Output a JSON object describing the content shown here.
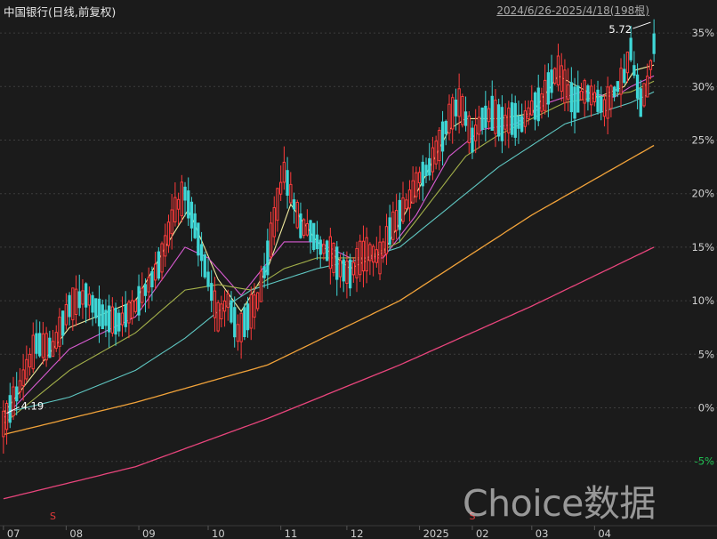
{
  "header": {
    "title": "中国银行(日线,前复权)",
    "range": "2024/6/26-2025/4/18(198根)"
  },
  "watermark": "Choice数据",
  "chart_data": {
    "type": "candlestick",
    "title": "中国银行(日线,前复权)",
    "date_range": "2024/6/26-2025/4/18",
    "bar_count": 198,
    "y_unit": "% change",
    "y_ticks": [
      "35%",
      "30%",
      "25%",
      "20%",
      "15%",
      "10%",
      "5%",
      "0%",
      "-5%"
    ],
    "ylim": [
      -8,
      37
    ],
    "x_ticks": [
      "07",
      "08",
      "09",
      "10",
      "11",
      "12",
      "2025",
      "02",
      "03",
      "04"
    ],
    "annotations": {
      "low_price": "4.19",
      "high_price": "5.72"
    },
    "price_path": [
      [
        0,
        -1.5
      ],
      [
        5,
        2
      ],
      [
        10,
        6
      ],
      [
        15,
        5.5
      ],
      [
        20,
        9.5
      ],
      [
        25,
        10.5
      ],
      [
        30,
        8.5
      ],
      [
        35,
        8
      ],
      [
        40,
        9.5
      ],
      [
        45,
        12
      ],
      [
        48,
        14
      ],
      [
        52,
        18.5
      ],
      [
        55,
        20
      ],
      [
        58,
        17
      ],
      [
        62,
        12
      ],
      [
        65,
        8.5
      ],
      [
        68,
        10
      ],
      [
        71,
        7
      ],
      [
        74,
        8.5
      ],
      [
        77,
        10
      ],
      [
        80,
        14
      ],
      [
        83,
        19
      ],
      [
        85,
        22
      ],
      [
        87,
        20
      ],
      [
        90,
        17
      ],
      [
        93,
        16.5
      ],
      [
        96,
        15
      ],
      [
        99,
        14.5
      ],
      [
        102,
        13
      ],
      [
        105,
        12.5
      ],
      [
        108,
        14
      ],
      [
        111,
        14.5
      ],
      [
        114,
        14
      ],
      [
        117,
        16.5
      ],
      [
        120,
        18
      ],
      [
        123,
        19.5
      ],
      [
        126,
        21.5
      ],
      [
        129,
        22.5
      ],
      [
        132,
        24.5
      ],
      [
        135,
        27
      ],
      [
        138,
        28.5
      ],
      [
        140,
        27
      ],
      [
        142,
        25
      ],
      [
        145,
        27
      ],
      [
        148,
        27.5
      ],
      [
        151,
        26.5
      ],
      [
        154,
        27
      ],
      [
        157,
        26.5
      ],
      [
        160,
        28
      ],
      [
        163,
        28.5
      ],
      [
        166,
        30.5
      ],
      [
        168,
        31.5
      ],
      [
        170,
        30
      ],
      [
        173,
        28.5
      ],
      [
        176,
        29.5
      ],
      [
        179,
        29
      ],
      [
        182,
        28
      ],
      [
        184,
        29
      ],
      [
        186,
        30
      ],
      [
        188,
        31
      ],
      [
        190,
        33.5
      ],
      [
        191,
        31.5
      ],
      [
        193,
        28.5
      ],
      [
        195,
        30
      ],
      [
        196,
        32
      ],
      [
        197,
        34
      ]
    ],
    "series": [
      {
        "name": "",
        "color": "#f2ec9f",
        "path": [
          [
            0,
            -0.5
          ],
          [
            20,
            7.5
          ],
          [
            40,
            10
          ],
          [
            50,
            15.5
          ],
          [
            56,
            18.5
          ],
          [
            65,
            12
          ],
          [
            72,
            9
          ],
          [
            80,
            13
          ],
          [
            87,
            19
          ],
          [
            95,
            15.5
          ],
          [
            105,
            13
          ],
          [
            115,
            14.5
          ],
          [
            125,
            20
          ],
          [
            135,
            26
          ],
          [
            140,
            27
          ],
          [
            150,
            27
          ],
          [
            160,
            27.5
          ],
          [
            168,
            31
          ],
          [
            180,
            29
          ],
          [
            188,
            30
          ],
          [
            191,
            31.5
          ],
          [
            197,
            32
          ]
        ]
      },
      {
        "name": "",
        "color": "#d85bd1",
        "path": [
          [
            0,
            -1
          ],
          [
            20,
            5.5
          ],
          [
            40,
            8.5
          ],
          [
            55,
            15
          ],
          [
            62,
            14
          ],
          [
            72,
            10.5
          ],
          [
            85,
            15.5
          ],
          [
            95,
            15.5
          ],
          [
            105,
            14
          ],
          [
            115,
            14
          ],
          [
            125,
            18
          ],
          [
            135,
            23.5
          ],
          [
            145,
            26
          ],
          [
            155,
            26.5
          ],
          [
            165,
            28.5
          ],
          [
            175,
            29.5
          ],
          [
            185,
            29
          ],
          [
            190,
            30
          ],
          [
            197,
            31
          ]
        ]
      },
      {
        "name": "",
        "color": "#a3b04a",
        "path": [
          [
            0,
            -1.5
          ],
          [
            20,
            3.5
          ],
          [
            40,
            7
          ],
          [
            55,
            11
          ],
          [
            65,
            11.5
          ],
          [
            75,
            11
          ],
          [
            85,
            13
          ],
          [
            95,
            14
          ],
          [
            110,
            14
          ],
          [
            120,
            15.5
          ],
          [
            130,
            19.5
          ],
          [
            140,
            23.5
          ],
          [
            150,
            25.5
          ],
          [
            160,
            27
          ],
          [
            170,
            28.5
          ],
          [
            180,
            29
          ],
          [
            190,
            29.5
          ],
          [
            197,
            30.5
          ]
        ]
      },
      {
        "name": "",
        "color": "#5fc7c2",
        "path": [
          [
            0,
            -0.5
          ],
          [
            20,
            1
          ],
          [
            40,
            3.5
          ],
          [
            55,
            6.5
          ],
          [
            65,
            9
          ],
          [
            75,
            11
          ],
          [
            85,
            12
          ],
          [
            95,
            13
          ],
          [
            110,
            14
          ],
          [
            120,
            15
          ],
          [
            130,
            17.5
          ],
          [
            140,
            20
          ],
          [
            150,
            22.5
          ],
          [
            160,
            24.5
          ],
          [
            170,
            26.5
          ],
          [
            180,
            27.5
          ],
          [
            190,
            28.5
          ],
          [
            197,
            29.5
          ]
        ]
      },
      {
        "name": "",
        "color": "#f2a33a",
        "path": [
          [
            0,
            -2.5
          ],
          [
            40,
            0.5
          ],
          [
            80,
            4
          ],
          [
            120,
            10
          ],
          [
            160,
            18
          ],
          [
            197,
            24.5
          ]
        ]
      },
      {
        "name": "",
        "color": "#e8457c",
        "path": [
          [
            0,
            -8.5
          ],
          [
            40,
            -5.5
          ],
          [
            80,
            -1
          ],
          [
            120,
            4
          ],
          [
            160,
            9.5
          ],
          [
            197,
            15
          ]
        ]
      }
    ],
    "event_markers": [
      {
        "x_index": 15,
        "label": "S"
      },
      {
        "x_index": 142,
        "label": "S"
      }
    ]
  }
}
